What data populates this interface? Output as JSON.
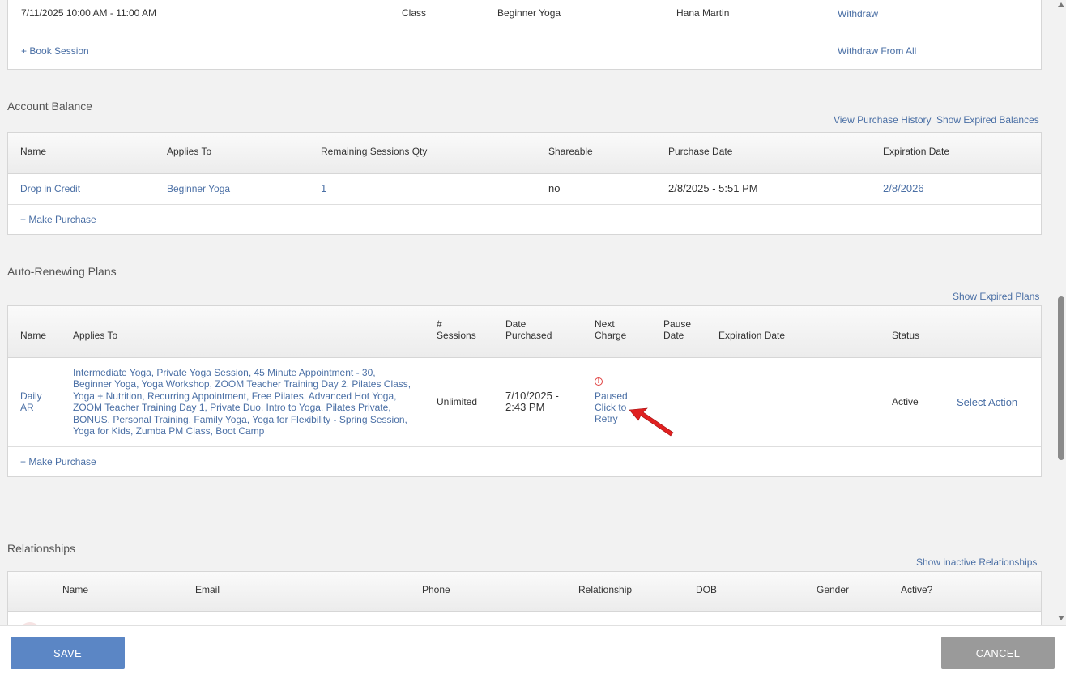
{
  "sessions": {
    "row": {
      "datetime": "7/11/2025 10:00 AM - 11:00 AM",
      "type": "Class",
      "name": "Beginner Yoga",
      "staff": "Hana Martin",
      "withdraw": "Withdraw"
    },
    "book_session": "+ Book Session",
    "withdraw_all": "Withdraw From All"
  },
  "account_balance": {
    "title": "Account Balance",
    "view_history": "View Purchase History",
    "show_expired": "Show Expired Balances",
    "headers": [
      "Name",
      "Applies To",
      "Remaining Sessions Qty",
      "Shareable",
      "Purchase Date",
      "Expiration Date"
    ],
    "row": {
      "name": "Drop in Credit",
      "applies_to": "Beginner Yoga",
      "remaining": "1",
      "shareable": "no",
      "purchase_date": "2/8/2025 - 5:51 PM",
      "expiration_date": "2/8/2026"
    },
    "make_purchase": "+ Make Purchase"
  },
  "auto_renewing": {
    "title": "Auto-Renewing Plans",
    "show_expired": "Show Expired Plans",
    "headers": {
      "name": "Name",
      "applies_to": "Applies To",
      "sessions_1": "#",
      "sessions_2": "Sessions",
      "date_1": "Date",
      "date_2": "Purchased",
      "next_1": "Next",
      "next_2": "Charge",
      "pause_1": "Pause",
      "pause_2": "Date",
      "expiration": "Expiration Date",
      "status": "Status"
    },
    "row": {
      "name": "Daily AR",
      "applies_to": "Intermediate Yoga, Private Yoga Session, 45 Minute Appointment - 30, Beginner Yoga, Yoga Workshop, ZOOM Teacher Training Day 2, Pilates Class, Yoga + Nutrition, Recurring Appointment, Free Pilates, Advanced Hot Yoga, ZOOM Teacher Training Day 1, Private Duo, Intro to Yoga, Pilates Private, BONUS, Personal Training, Family Yoga, Yoga for Flexibility - Spring Session, Yoga for Kids, Zumba PM Class, Boot Camp",
      "sessions": "Unlimited",
      "date_purchased": "7/10/2025 - 2:43 PM",
      "next_charge": "Paused Click to Retry",
      "status": "Active",
      "action": "Select Action"
    },
    "make_purchase": "+ Make Purchase"
  },
  "relationships": {
    "title": "Relationships",
    "show_inactive": "Show inactive Relationships",
    "headers": [
      "Name",
      "Email",
      "Phone",
      "Relationship",
      "DOB",
      "Gender",
      "Active?"
    ]
  },
  "footer": {
    "save": "SAVE",
    "cancel": "CANCEL"
  },
  "colors": {
    "link": "#4a6fa5",
    "save_button": "#5b86c5",
    "cancel_button": "#9a9a9a",
    "alert": "#e04040",
    "annotation_arrow": "#e02020"
  },
  "icons": [
    "alert-circle-icon",
    "red-pointer-arrow-icon",
    "scroll-up-icon",
    "scroll-down-icon"
  ]
}
